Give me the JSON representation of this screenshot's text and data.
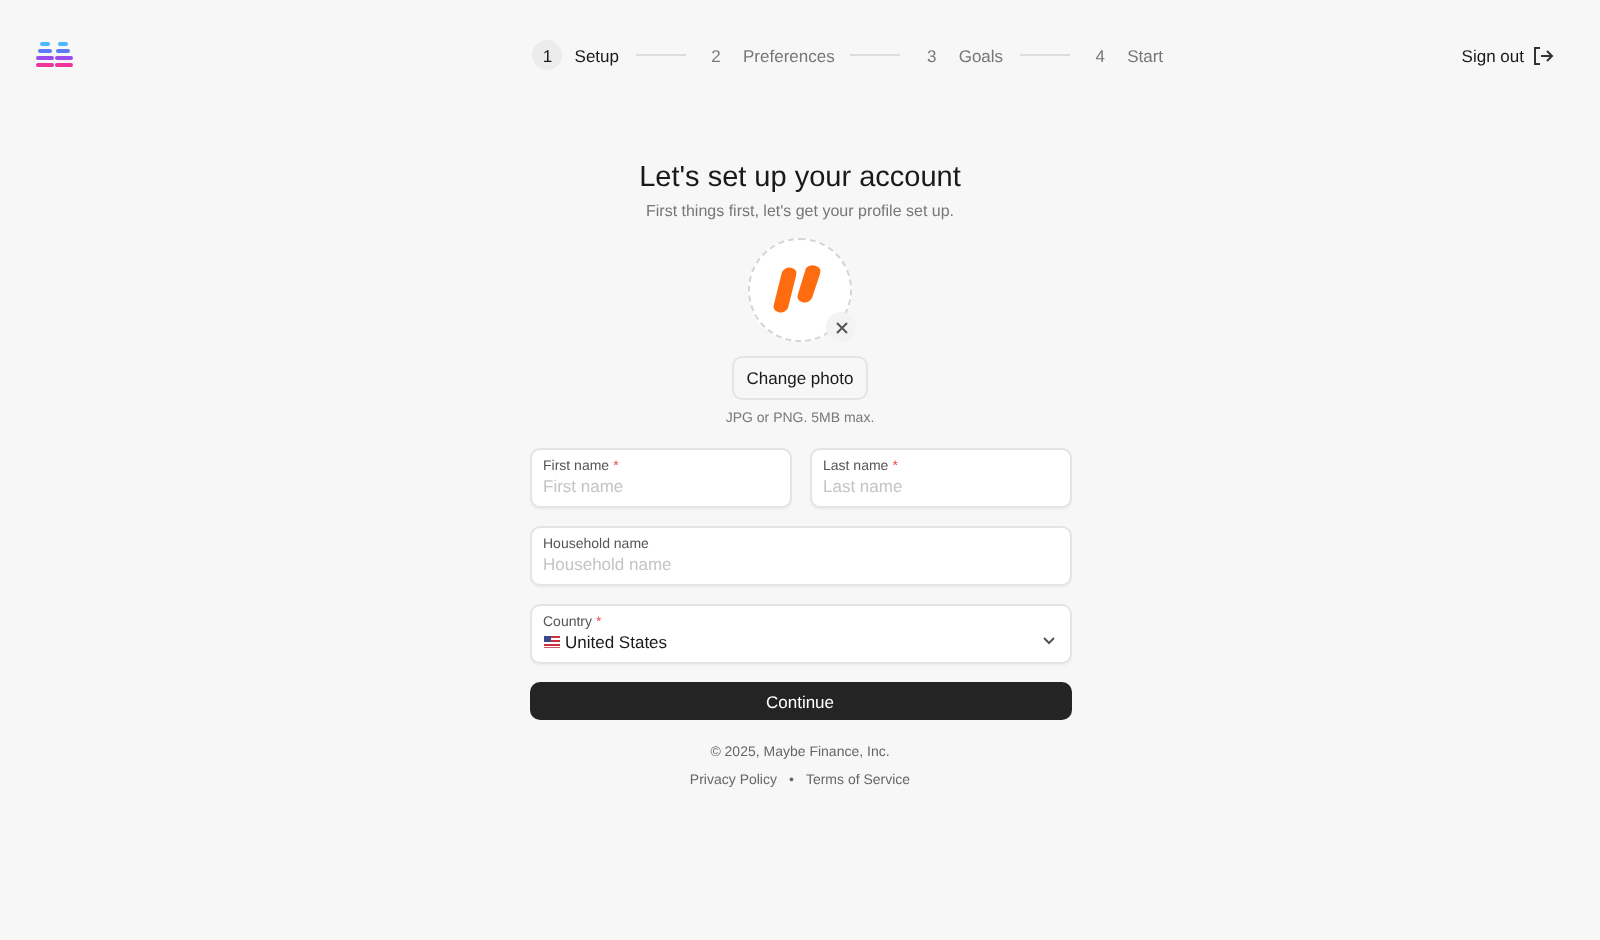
{
  "header": {
    "steps": [
      {
        "number": "1",
        "label": "Setup",
        "selected": true
      },
      {
        "number": "2",
        "label": "Preferences",
        "selected": false
      },
      {
        "number": "3",
        "label": "Goals",
        "selected": false
      },
      {
        "number": "4",
        "label": "Start",
        "selected": false
      }
    ],
    "sign_out": "Sign out"
  },
  "title": "Let's set up your account",
  "subtitle": "First things first, let's get your profile set up.",
  "photo": {
    "button": "Change photo",
    "hint": "JPG or PNG. 5MB max."
  },
  "fields": [
    {
      "kind": "text",
      "label": "First name",
      "required": true,
      "placeholder": "First name"
    },
    {
      "kind": "text",
      "label": "Last name",
      "required": true,
      "placeholder": "Last name"
    },
    {
      "kind": "text",
      "label": "Household name",
      "required": false,
      "placeholder": "Household name"
    },
    {
      "kind": "select",
      "label": "Country",
      "required": true,
      "value": "United States"
    }
  ],
  "required_mark": "*",
  "continue": "Continue",
  "footer": {
    "copyright": "© 2025, Maybe Finance, Inc.",
    "links": [
      "Privacy Policy",
      "Terms of Service"
    ],
    "separator": "•"
  }
}
